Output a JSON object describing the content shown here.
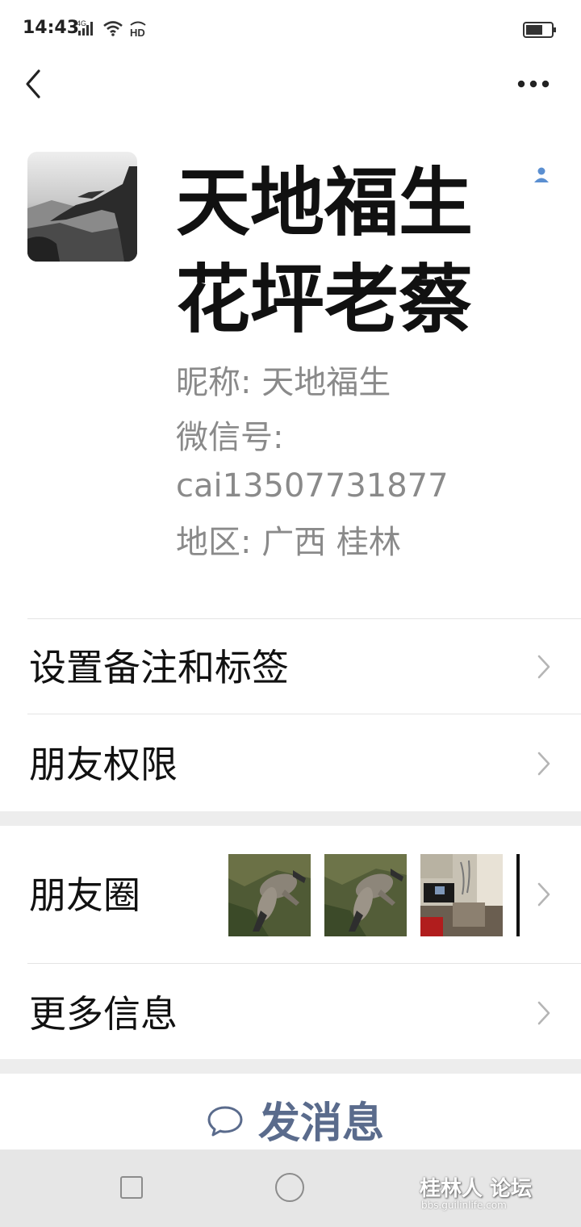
{
  "status_bar": {
    "time": "14:43",
    "network": "4G",
    "hd": "HD"
  },
  "profile": {
    "display_name": "天地福生花坪老蔡",
    "nickname_line": "昵称:  天地福生",
    "wechat_id_label": "微信号:",
    "wechat_id": "cai13507731877",
    "region_line": "地区:  广西  桂林"
  },
  "menu": {
    "remark_tags": "设置备注和标签",
    "friend_permissions": "朋友权限",
    "moments": "朋友圈",
    "more_info": "更多信息"
  },
  "actions": {
    "send_message": "发消息"
  },
  "watermark": {
    "main": "桂林人 论坛",
    "sub": "bbs.guilinlife.com"
  },
  "colors": {
    "link_blue": "#5a6b8c",
    "secondary_text": "#8a8a8a",
    "band": "#ededed"
  }
}
